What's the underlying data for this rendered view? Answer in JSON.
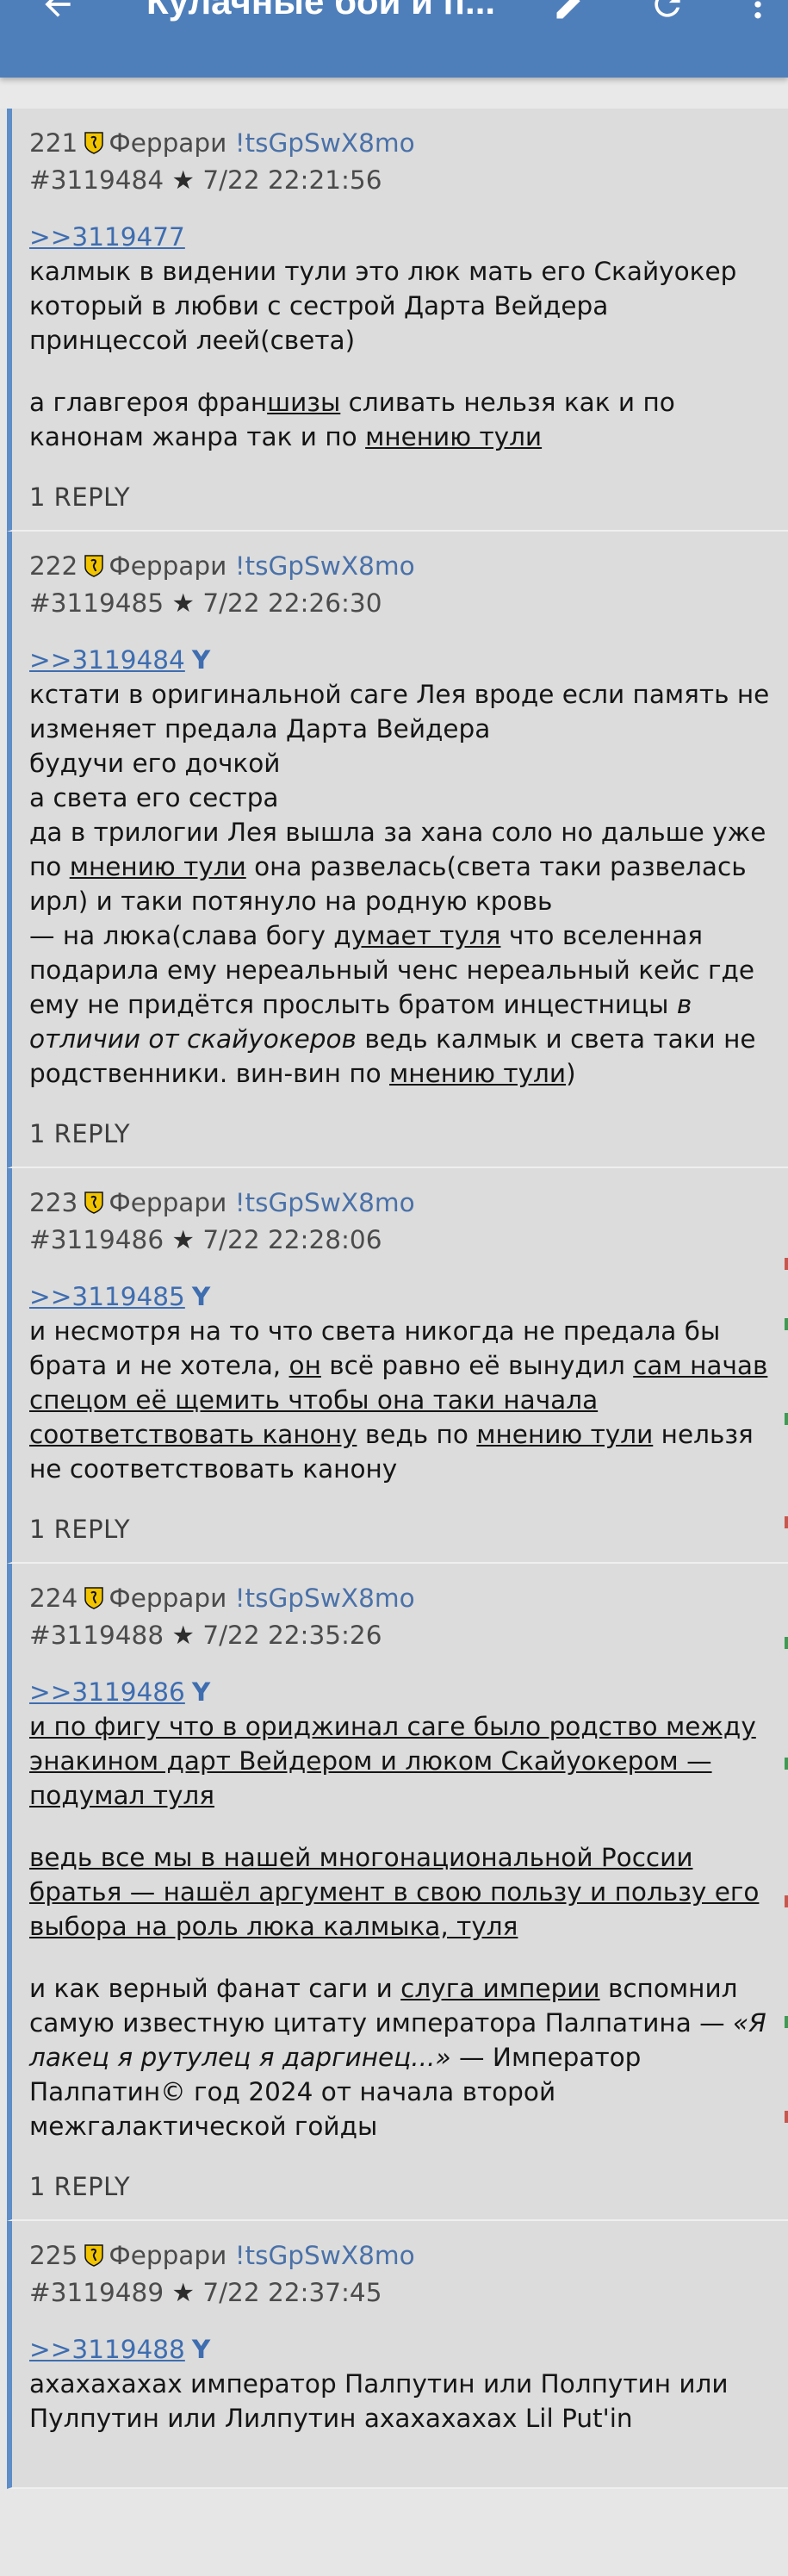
{
  "appbar": {
    "title": "Кулачные бои и п...",
    "back_icon": "arrow-back-icon",
    "actions": [
      "edit-icon",
      "refresh-icon",
      "more-vert-icon"
    ],
    "color": "#4f7fba"
  },
  "posts": [
    {
      "no": "221",
      "name": "Феррари",
      "trip": "!tsGpSwX8mo",
      "id": "#3119484",
      "date": "7/22 22:21:56",
      "quote": ">>3119477",
      "you": "",
      "p1": "калмык в видении тули это люк мать его Скайуокер который в любви с сестрой Дарта Вейдера принцессой леей(света)",
      "p2a": "а главгероя фран",
      "p2b": "шизы",
      "p2c": " сливать нельзя как и по канонам жанра так и по ",
      "p2d": "мнению тули",
      "replies": "1 REPLY"
    },
    {
      "no": "222",
      "name": "Феррари",
      "trip": "!tsGpSwX8mo",
      "id": "#3119485",
      "date": "7/22 22:26:30",
      "quote": ">>3119484",
      "you": "Y",
      "l1": "кстати в оригинальной саге Лея вроде если память не изменяет предала Дарта Вейдера",
      "l2": "будучи его дочкой",
      "l3": "а света его сестра",
      "l4a": "да в трилогии Лея вышла за хана соло но дальше уже по ",
      "l4b": "мнению тули",
      "l4c": " она развелась(света таки развелась ирл) и таки потянуло на родную кровь",
      "l5a": "— на люка(слава богу ",
      "l5b": "думает туля",
      "l5c": " что вселенная подарила ему нереальный ченс нереальный кейс где ему не придётся прослыть братом инцестницы ",
      "l5d": "в отличии от скайуокеров",
      "l5e": " ведь калмык и света таки не родственники. вин-вин по ",
      "l5f": "мнению тули",
      "l5g": ")",
      "replies": "1 REPLY"
    },
    {
      "no": "223",
      "name": "Феррари",
      "trip": "!tsGpSwX8mo",
      "id": "#3119486",
      "date": "7/22 22:28:06",
      "quote": ">>3119485",
      "you": "Y",
      "a": "и несмотря на то что света никогда не предала бы брата и не хотела, ",
      "b": "он",
      "c": " всё равно её вынудил ",
      "d": "сам начав спецом её щемить чтобы она таки начала соответствовать канону",
      "e": " ведь по ",
      "f": "мнению тули",
      "g": " нельзя не соответствовать канону",
      "replies": "1 REPLY"
    },
    {
      "no": "224",
      "name": "Феррари",
      "trip": "!tsGpSwX8mo",
      "id": "#3119488",
      "date": "7/22 22:35:26",
      "quote": ">>3119486",
      "you": "Y",
      "p1": "и по фигу что в ориджинал саге было родство между энакином дарт Вейдером и люком Скайуокером — подумал туля",
      "p2": "ведь все мы в нашей многонациональной России братья — нашёл аргумент в свою пользу и пользу его выбора на роль люка калмыка, туля",
      "p3a": "и как верный фанат саги и ",
      "p3b": "слуга империи",
      "p3c": " вспомнил самую известную цитату императора Палпатина — ",
      "p3d": "«Я лакец я рутулец я даргинец...»",
      "p3e": " — Император Палпатин© год 2024 от начала второй межгалактической гойды",
      "replies": "1 REPLY"
    },
    {
      "no": "225",
      "name": "Феррари",
      "trip": "!tsGpSwX8mo",
      "id": "#3119489",
      "date": "7/22 22:37:45",
      "quote": ">>3119488",
      "you": "Y",
      "p1": "ахахахахах император Палпутин или Полпутин или Пулпутин или Лилпутин ахахахахах Lil Put'in"
    }
  ]
}
